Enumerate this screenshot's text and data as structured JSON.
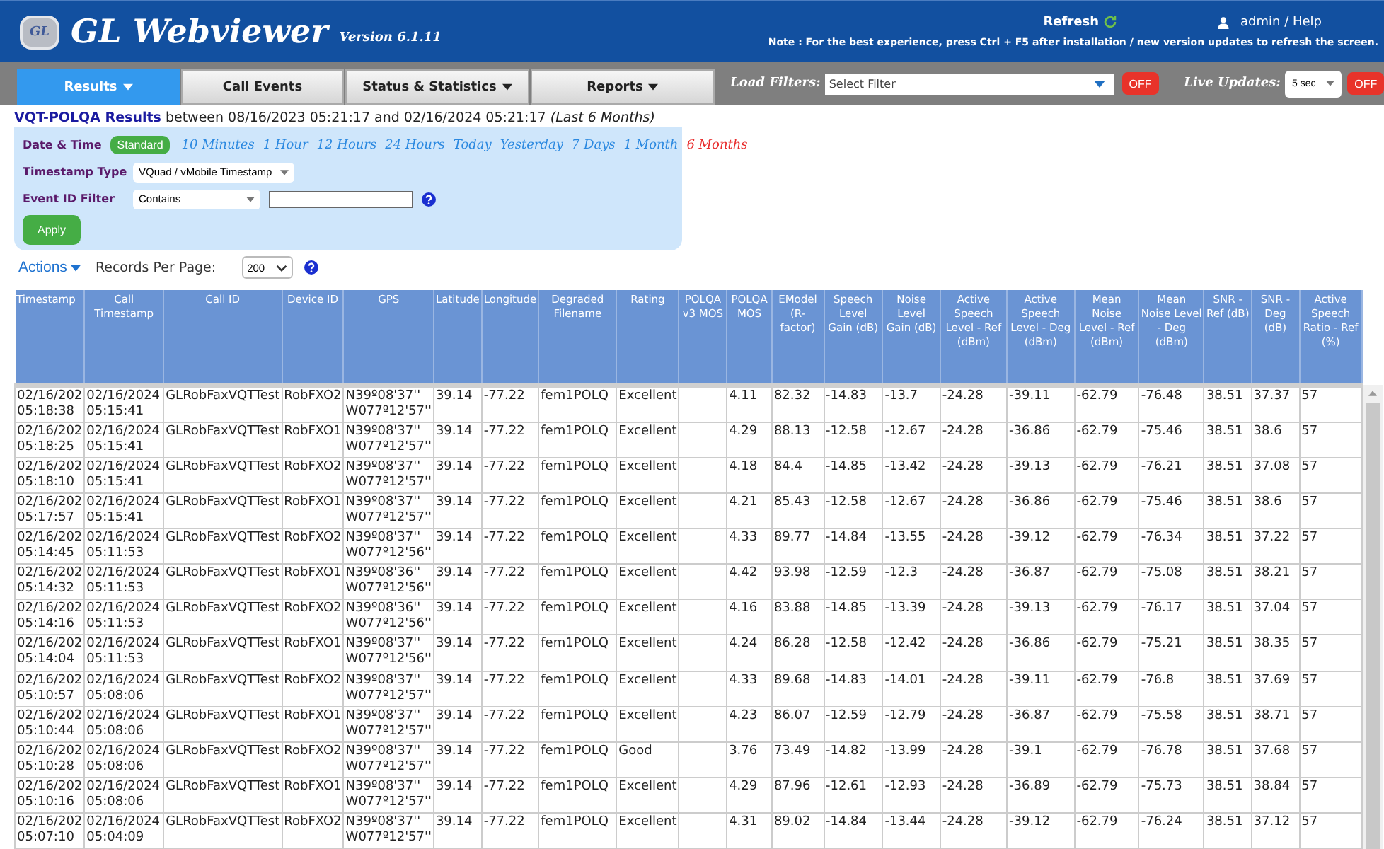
{
  "header": {
    "logo_text": "GL",
    "title": "GL Webviewer",
    "version": "Version 6.1.11",
    "refresh": "Refresh",
    "user": "admin / Help",
    "note": "Note : For the best experience, press Ctrl + F5 after installation / new version updates to refresh the screen."
  },
  "nav": {
    "tabs": [
      {
        "label": "Results",
        "selected": true,
        "dropdown": true
      },
      {
        "label": "Call Events",
        "selected": false,
        "dropdown": false
      },
      {
        "label": "Status & Statistics",
        "selected": false,
        "dropdown": true
      },
      {
        "label": "Reports",
        "selected": false,
        "dropdown": true
      }
    ],
    "load_filters": {
      "label": "Load Filters:",
      "placeholder": "Select Filter",
      "toggle": "OFF"
    },
    "live_updates": {
      "label": "Live Updates:",
      "value": "5 sec",
      "toggle": "OFF"
    }
  },
  "results": {
    "title": "VQT-POLQA Results",
    "range": "between 08/16/2023 05:21:17 and 02/16/2024 05:21:17",
    "range_note": "(Last 6 Months)"
  },
  "filters": {
    "date_time": {
      "label": "Date & Time",
      "button": "Standard",
      "presets": [
        {
          "label": "10 Minutes",
          "selected": false
        },
        {
          "label": "1 Hour",
          "selected": false
        },
        {
          "label": "12 Hours",
          "selected": false
        },
        {
          "label": "24 Hours",
          "selected": false
        },
        {
          "label": "Today",
          "selected": false
        },
        {
          "label": "Yesterday",
          "selected": false
        },
        {
          "label": "7 Days",
          "selected": false
        },
        {
          "label": "1 Month",
          "selected": false
        },
        {
          "label": "6 Months",
          "selected": true
        }
      ]
    },
    "timestamp_type": {
      "label": "Timestamp Type",
      "value": "VQuad / vMobile Timestamp"
    },
    "event_id": {
      "label": "Event ID Filter",
      "operator": "Contains"
    },
    "apply": "Apply"
  },
  "actions": {
    "label": "Actions",
    "records_label": "Records Per Page:",
    "records_value": "200"
  },
  "table": {
    "columns": [
      "Timestamp",
      "Call Timestamp",
      "Call ID",
      "Device ID",
      "GPS",
      "Latitude",
      "Longitude",
      "Degraded Filename",
      "Rating",
      "POLQA v3 MOS",
      "POLQA MOS",
      "EModel (R-factor)",
      "Speech Level Gain (dB)",
      "Noise Level Gain (dB)",
      "Active Speech Level - Ref (dBm)",
      "Active Speech Level - Deg (dBm)",
      "Mean Noise Level - Ref (dBm)",
      "Mean Noise Level - Deg (dBm)",
      "SNR - Ref (dB)",
      "SNR - Deg (dB)",
      "Active Speech Ratio - Ref (%)"
    ],
    "rows": [
      [
        "02/16/202\n05:18:38",
        "02/16/2024\n05:15:41",
        "GLRobFaxVQTTest",
        "RobFXO2",
        "N39º08'37''\nW077º12'57''",
        "39.14",
        "-77.22",
        "fem1POLQ",
        "Excellent",
        null,
        "4.11",
        "82.32",
        "-14.83",
        "-13.7",
        "-24.28",
        "-39.11",
        "-62.79",
        "-76.48",
        "38.51",
        "37.37",
        "57"
      ],
      [
        "02/16/202\n05:18:25",
        "02/16/2024\n05:15:41",
        "GLRobFaxVQTTest",
        "RobFXO1",
        "N39º08'37''\nW077º12'57''",
        "39.14",
        "-77.22",
        "fem1POLQ",
        "Excellent",
        null,
        "4.29",
        "88.13",
        "-12.58",
        "-12.67",
        "-24.28",
        "-36.86",
        "-62.79",
        "-75.46",
        "38.51",
        "38.6",
        "57"
      ],
      [
        "02/16/202\n05:18:10",
        "02/16/2024\n05:15:41",
        "GLRobFaxVQTTest",
        "RobFXO2",
        "N39º08'37''\nW077º12'57''",
        "39.14",
        "-77.22",
        "fem1POLQ",
        "Excellent",
        null,
        "4.18",
        "84.4",
        "-14.85",
        "-13.42",
        "-24.28",
        "-39.13",
        "-62.79",
        "-76.21",
        "38.51",
        "37.08",
        "57"
      ],
      [
        "02/16/202\n05:17:57",
        "02/16/2024\n05:15:41",
        "GLRobFaxVQTTest",
        "RobFXO1",
        "N39º08'37''\nW077º12'57''",
        "39.14",
        "-77.22",
        "fem1POLQ",
        "Excellent",
        null,
        "4.21",
        "85.43",
        "-12.58",
        "-12.67",
        "-24.28",
        "-36.86",
        "-62.79",
        "-75.46",
        "38.51",
        "38.6",
        "57"
      ],
      [
        "02/16/202\n05:14:45",
        "02/16/2024\n05:11:53",
        "GLRobFaxVQTTest",
        "RobFXO2",
        "N39º08'37''\nW077º12'56''",
        "39.14",
        "-77.22",
        "fem1POLQ",
        "Excellent",
        null,
        "4.33",
        "89.77",
        "-14.84",
        "-13.55",
        "-24.28",
        "-39.12",
        "-62.79",
        "-76.34",
        "38.51",
        "37.22",
        "57"
      ],
      [
        "02/16/202\n05:14:32",
        "02/16/2024\n05:11:53",
        "GLRobFaxVQTTest",
        "RobFXO1",
        "N39º08'36''\nW077º12'56''",
        "39.14",
        "-77.22",
        "fem1POLQ",
        "Excellent",
        null,
        "4.42",
        "93.98",
        "-12.59",
        "-12.3",
        "-24.28",
        "-36.87",
        "-62.79",
        "-75.08",
        "38.51",
        "38.21",
        "57"
      ],
      [
        "02/16/202\n05:14:16",
        "02/16/2024\n05:11:53",
        "GLRobFaxVQTTest",
        "RobFXO2",
        "N39º08'36''\nW077º12'56''",
        "39.14",
        "-77.22",
        "fem1POLQ",
        "Excellent",
        null,
        "4.16",
        "83.88",
        "-14.85",
        "-13.39",
        "-24.28",
        "-39.13",
        "-62.79",
        "-76.17",
        "38.51",
        "37.04",
        "57"
      ],
      [
        "02/16/202\n05:14:04",
        "02/16/2024\n05:11:53",
        "GLRobFaxVQTTest",
        "RobFXO1",
        "N39º08'37''\nW077º12'56''",
        "39.14",
        "-77.22",
        "fem1POLQ",
        "Excellent",
        null,
        "4.24",
        "86.28",
        "-12.58",
        "-12.42",
        "-24.28",
        "-36.86",
        "-62.79",
        "-75.21",
        "38.51",
        "38.35",
        "57"
      ],
      [
        "02/16/202\n05:10:57",
        "02/16/2024\n05:08:06",
        "GLRobFaxVQTTest",
        "RobFXO2",
        "N39º08'37''\nW077º12'57''",
        "39.14",
        "-77.22",
        "fem1POLQ",
        "Excellent",
        null,
        "4.33",
        "89.68",
        "-14.83",
        "-14.01",
        "-24.28",
        "-39.11",
        "-62.79",
        "-76.8",
        "38.51",
        "37.69",
        "57"
      ],
      [
        "02/16/202\n05:10:44",
        "02/16/2024\n05:08:06",
        "GLRobFaxVQTTest",
        "RobFXO1",
        "N39º08'37''\nW077º12'57''",
        "39.14",
        "-77.22",
        "fem1POLQ",
        "Excellent",
        null,
        "4.23",
        "86.07",
        "-12.59",
        "-12.79",
        "-24.28",
        "-36.87",
        "-62.79",
        "-75.58",
        "38.51",
        "38.71",
        "57"
      ],
      [
        "02/16/202\n05:10:28",
        "02/16/2024\n05:08:06",
        "GLRobFaxVQTTest",
        "RobFXO2",
        "N39º08'37''\nW077º12'57''",
        "39.14",
        "-77.22",
        "fem1POLQ",
        "Good",
        null,
        "3.76",
        "73.49",
        "-14.82",
        "-13.99",
        "-24.28",
        "-39.1",
        "-62.79",
        "-76.78",
        "38.51",
        "37.68",
        "57"
      ],
      [
        "02/16/202\n05:10:16",
        "02/16/2024\n05:08:06",
        "GLRobFaxVQTTest",
        "RobFXO1",
        "N39º08'37''\nW077º12'57''",
        "39.14",
        "-77.22",
        "fem1POLQ",
        "Excellent",
        null,
        "4.29",
        "87.96",
        "-12.61",
        "-12.93",
        "-24.28",
        "-36.89",
        "-62.79",
        "-75.73",
        "38.51",
        "38.84",
        "57"
      ],
      [
        "02/16/202\n05:07:10",
        "02/16/2024\n05:04:09",
        "GLRobFaxVQTTest",
        "RobFXO2",
        "N39º08'37''\nW077º12'57''",
        "39.14",
        "-77.22",
        "fem1POLQ",
        "Excellent",
        null,
        "4.31",
        "89.02",
        "-14.84",
        "-13.44",
        "-24.28",
        "-39.12",
        "-62.79",
        "-76.24",
        "38.51",
        "37.12",
        "57"
      ]
    ]
  }
}
